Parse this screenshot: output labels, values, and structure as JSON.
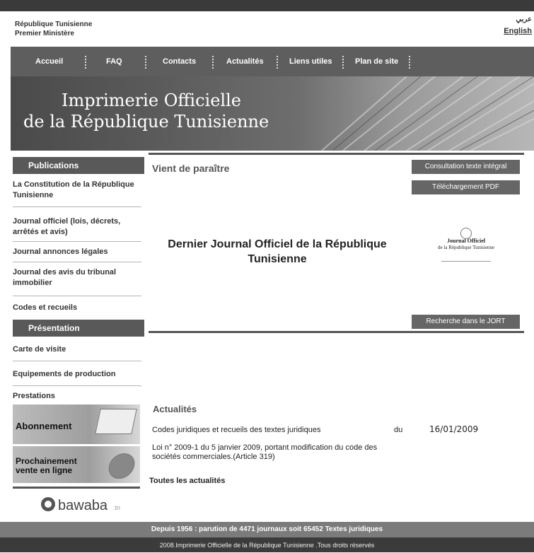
{
  "header": {
    "gov_line1": "République Tunisienne",
    "gov_line2": "Premier Ministère",
    "lang_arabic": "عربي",
    "lang_english": "English"
  },
  "nav": {
    "items": [
      "Accueil",
      "FAQ",
      "Contacts",
      "Actualités",
      "Liens utiles",
      "Plan de site"
    ]
  },
  "banner": {
    "title_line1": "Imprimerie Officielle",
    "title_line2": "de la République Tunisienne"
  },
  "sidebar": {
    "publications_title": "Publications",
    "publications": [
      "La Constitution de la République Tunisienne",
      "Journal officiel (lois, décrets, arrêtés et avis)",
      "Journal annonces légales",
      "Journal des avis du tribunal immobilier",
      "Codes et recueils"
    ],
    "presentation_title": "Présentation",
    "presentation": [
      "Carte de visite",
      "Equipements de production",
      "Prestations"
    ],
    "abonnement": "Abonnement",
    "vente_line1": "Prochainement",
    "vente_line2": "vente en ligne",
    "partner_logo": "bawaba.tn"
  },
  "main": {
    "vient_de_paraitre": "Vient de paraître",
    "btn_consultation": "Consultation texte intégral",
    "btn_telechargement": "Téléchargement PDF",
    "headline": "Dernier Journal Officiel de la République Tunisienne",
    "cover_line1": "Journal Officiel",
    "cover_line2": "de la République Tunisienne",
    "btn_recherche": "Recherche dans le JORT",
    "actualites_title": "Actualités",
    "news1_title": "Codes juridiques et recueils des textes juridiques",
    "news1_du": "du",
    "news1_date": "16/01/2009",
    "news2_title": "Loi n° 2009-1 du 5 janvier 2009, portant modification du code des sociétés commerciales.(Article 319)",
    "toutes": "Toutes les actualités"
  },
  "footer": {
    "stats": "Depuis 1956 : parution de 4471 journaux soit 65452 Textes juridiques",
    "copyright": "2008.Imprimerie Officielle de la République Tunisienne .Tous droits réservés"
  },
  "colors": {
    "nav_bg": "#5e5e5e",
    "sidebar_head_bg": "#595959",
    "button_bg": "#666666",
    "footer_bg": "#7b7b7b",
    "footer2_bg": "#3b3b3b"
  }
}
